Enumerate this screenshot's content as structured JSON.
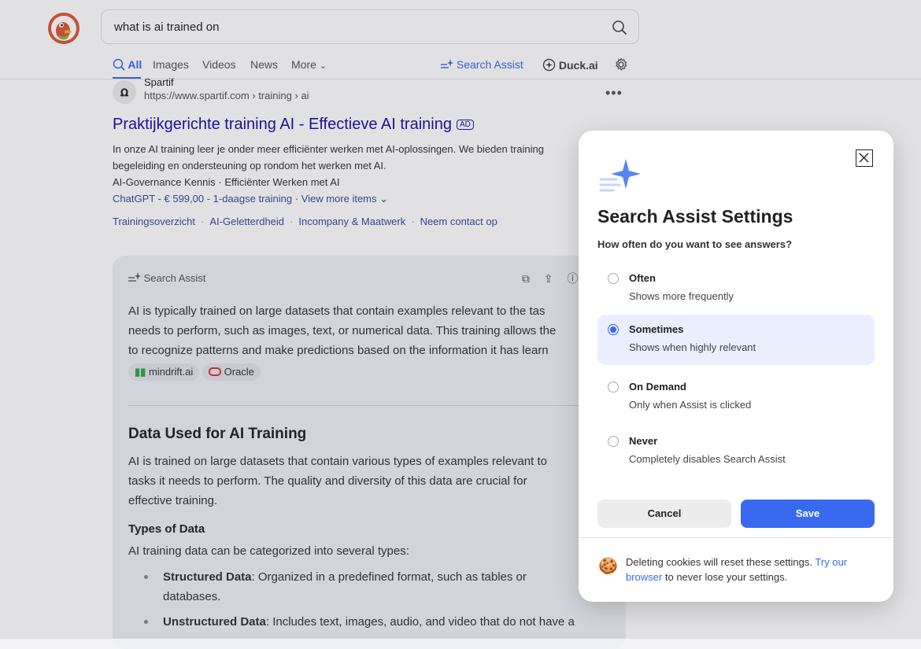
{
  "search": {
    "query": "what is ai trained on"
  },
  "tabs": [
    {
      "label": "All"
    },
    {
      "label": "Images"
    },
    {
      "label": "Videos"
    },
    {
      "label": "News"
    },
    {
      "label": "More"
    }
  ],
  "right_tabs": {
    "search_assist": "Search Assist",
    "duck_ai": "Duck.ai"
  },
  "result": {
    "site_name": "Spartif",
    "url": "https://www.spartif.com › training › ai",
    "title": "Praktijkgerichte training AI - Effectieve AI training",
    "ad_label": "AD",
    "snippet_1": "In onze AI training leer je onder meer efficiënter werken met AI-oplossingen. We bieden training",
    "snippet_2": "begeleiding en ondersteuning op rondom het werken met AI.",
    "snippet_3": "AI-Governance Kennis · Efficiënter Werken met AI",
    "price_line": "ChatGPT - € 599,00 - 1-daagse training · View more items",
    "sitelinks": [
      "Trainingsoverzicht",
      "AI-Geletterdheid",
      "Incompany & Maatwerk",
      "Neem contact op"
    ]
  },
  "assist": {
    "header": "Search Assist",
    "intro": [
      "AI is typically trained on large datasets that contain examples relevant to the tas",
      "needs to perform, such as images, text, or numerical data. This training allows the",
      "to recognize patterns and make predictions based on the information it has learn"
    ],
    "sources": [
      "mindrift.ai",
      "Oracle"
    ],
    "h2": "Data Used for AI Training",
    "p2": [
      "AI is trained on large datasets that contain various types of examples relevant to",
      "tasks it needs to perform. The quality and diversity of this data are crucial for",
      "effective training."
    ],
    "h3": "Types of Data",
    "p3": "AI training data can be categorized into several types:",
    "list": [
      {
        "term": "Structured Data",
        "text": ": Organized in a predefined format, such as tables or",
        "cont": "databases."
      },
      {
        "term": "Unstructured Data",
        "text": ": Includes text, images, audio, and video that do not have a",
        "cont": ""
      }
    ]
  },
  "modal": {
    "title": "Search Assist Settings",
    "question": "How often do you want to see answers?",
    "options": [
      {
        "label": "Often",
        "desc": "Shows more frequently"
      },
      {
        "label": "Sometimes",
        "desc": "Shows when highly relevant"
      },
      {
        "label": "On Demand",
        "desc": "Only when Assist is clicked"
      },
      {
        "label": "Never",
        "desc": "Completely disables Search Assist"
      }
    ],
    "selected": "Sometimes",
    "cancel": "Cancel",
    "save": "Save",
    "cookie_text": "Deleting cookies will reset these settings.",
    "cookie_link": "Try our browser",
    "cookie_tail": "to never lose your settings."
  },
  "colors": {
    "accent": "#3969ef",
    "ad_link": "#1a0dab",
    "sitelink": "#3a4aa0"
  }
}
